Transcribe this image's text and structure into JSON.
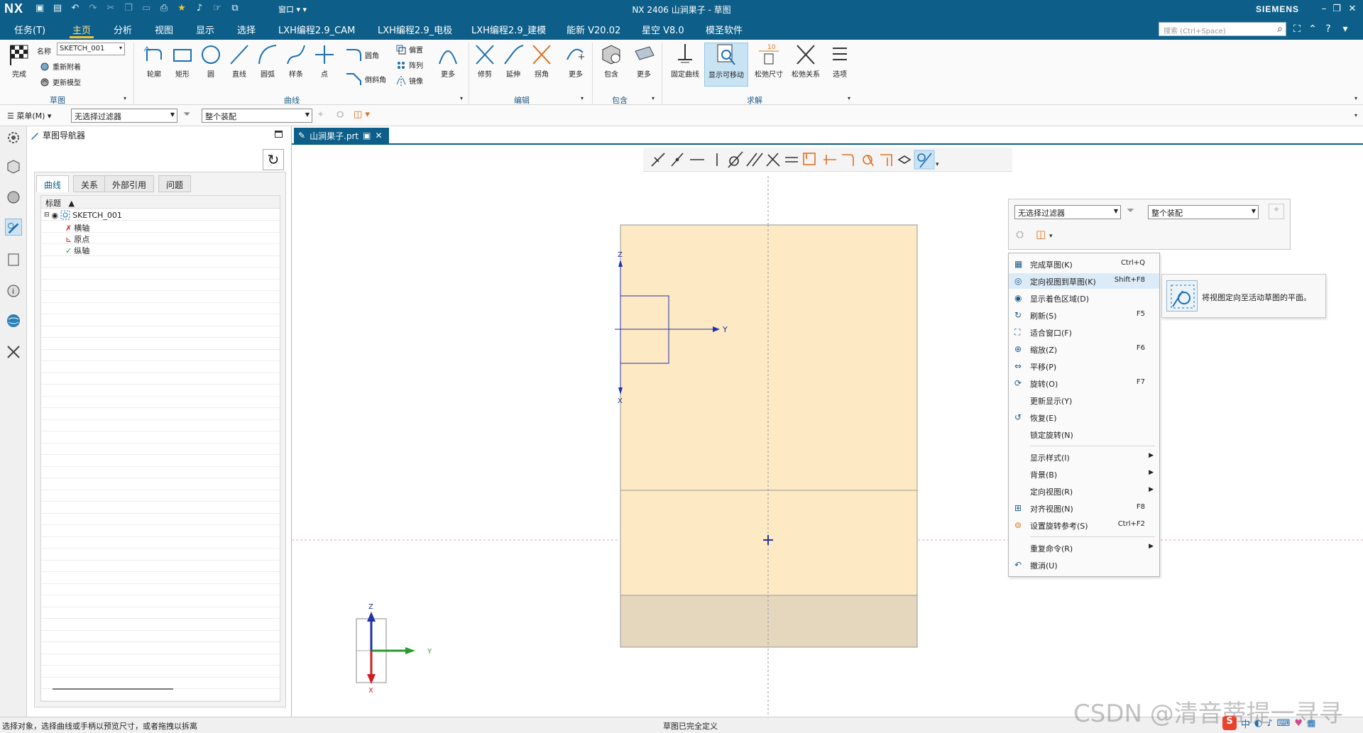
{
  "app": {
    "logo": "NX",
    "title": "NX 2406 山涧果子 - 草图",
    "brand": "SIEMENS",
    "window_menu": "窗口"
  },
  "colors": {
    "titlebar": "#0d5f8a",
    "accent_tab": "#f5c232",
    "sketch_face": "#fde9c3",
    "sketch_bottom": "#e4d7bd",
    "axis_blue": "#2233aa",
    "axis_green": "#2a9a2a",
    "axis_red": "#cc2222",
    "ctx_highlight": "#dbecf8"
  },
  "menu_tabs": [
    "任务(T)",
    "主页",
    "分析",
    "视图",
    "显示",
    "选择",
    "LXH编程2.9_CAM",
    "LXH编程2.9_电极",
    "LXH编程2.9_建模",
    "能新 V20.02",
    "星空 V8.0",
    "模圣软件"
  ],
  "active_tab": "主页",
  "search": {
    "placeholder": "搜索 (Ctrl+Space)"
  },
  "ribbon": {
    "finish_label": "完成",
    "name_label": "名称",
    "sketch_name": "SKETCH_001",
    "reattach": "重新附着",
    "update_model": "更新模型",
    "group_sketch": "草图",
    "curve_tools": [
      "轮廓",
      "矩形",
      "圆",
      "直线",
      "圆弧",
      "样条",
      "点"
    ],
    "fillet": "圆角",
    "chamfer": "倒斜角",
    "offset": "偏置",
    "pattern": "阵列",
    "mirror": "镜像",
    "more": "更多",
    "group_curve": "曲线",
    "edit_tools": [
      "修剪",
      "延伸",
      "拐角"
    ],
    "group_edit": "编辑",
    "include": "包含",
    "group_include": "包含",
    "solve_tools": [
      "固定曲线",
      "显示可移动",
      "松弛尺寸",
      "松弛关系",
      "选项"
    ],
    "group_solve": "求解"
  },
  "filterbar": {
    "menu_label": "菜单(M)",
    "filter_value": "无选择过滤器",
    "scope_value": "整个装配"
  },
  "navigator": {
    "title": "草图导航器",
    "tabs": [
      "曲线",
      "关系",
      "外部引用",
      "问题"
    ],
    "column_header": "标题",
    "tree": [
      {
        "label": "SKETCH_001",
        "icon": "sketch-icon"
      },
      {
        "label": "横轴",
        "icon": "x-axis-icon"
      },
      {
        "label": "原点",
        "icon": "origin-icon"
      },
      {
        "label": "纵轴",
        "icon": "y-axis-icon"
      }
    ]
  },
  "document_tab": {
    "label": "山涧果子.prt"
  },
  "canvas": {
    "axis_labels": {
      "z": "Z",
      "y": "Y",
      "x": "X"
    },
    "triad_labels": {
      "z": "Z",
      "y": "Y",
      "x": "X"
    }
  },
  "select_panel": {
    "filter_value": "无选择过滤器",
    "scope_value": "整个装配"
  },
  "context_menu": [
    {
      "label": "完成草图(K)",
      "shortcut": "Ctrl+Q",
      "icon": "checkered-flag-icon"
    },
    {
      "label": "定向视图到草图(K)",
      "shortcut": "Shift+F8",
      "icon": "orient-to-sketch-icon",
      "highlighted": true
    },
    {
      "label": "显示着色区域(D)",
      "shortcut": "",
      "icon": "eye-icon"
    },
    {
      "label": "刷新(S)",
      "shortcut": "F5",
      "icon": "refresh-icon"
    },
    {
      "label": "适合窗口(F)",
      "shortcut": "",
      "icon": "fit-icon"
    },
    {
      "label": "缩放(Z)",
      "shortcut": "F6",
      "icon": "zoom-icon"
    },
    {
      "label": "平移(P)",
      "shortcut": "",
      "icon": "pan-icon"
    },
    {
      "label": "旋转(O)",
      "shortcut": "F7",
      "icon": "rotate-icon"
    },
    {
      "label": "更新显示(Y)",
      "shortcut": "",
      "icon": ""
    },
    {
      "label": "恢复(E)",
      "shortcut": "",
      "icon": "restore-icon"
    },
    {
      "label": "锁定旋转(N)",
      "shortcut": "",
      "icon": ""
    },
    {
      "label": "显示样式(I)",
      "shortcut": "",
      "icon": "",
      "submenu": true,
      "sep_before": true
    },
    {
      "label": "背景(B)",
      "shortcut": "",
      "icon": "",
      "submenu": true
    },
    {
      "label": "定向视图(R)",
      "shortcut": "",
      "icon": "",
      "submenu": true
    },
    {
      "label": "对齐视图(N)",
      "shortcut": "F8",
      "icon": "align-view-icon"
    },
    {
      "label": "设置旋转参考(S)",
      "shortcut": "Ctrl+F2",
      "icon": "rotate-ref-icon"
    },
    {
      "label": "重复命令(R)",
      "shortcut": "",
      "icon": "",
      "submenu": true,
      "sep_before": true
    },
    {
      "label": "撤消(U)",
      "shortcut": "",
      "icon": "undo-icon"
    }
  ],
  "tooltip": {
    "text": "将视图定向至活动草图的平面。"
  },
  "status": {
    "left": "选择对象，选择曲线或手柄以预览尺寸，或者拖拽以拆离",
    "center": "草图已完全定义"
  },
  "watermark": "CSDN @清音蒂提一寻寻",
  "ime": "中"
}
